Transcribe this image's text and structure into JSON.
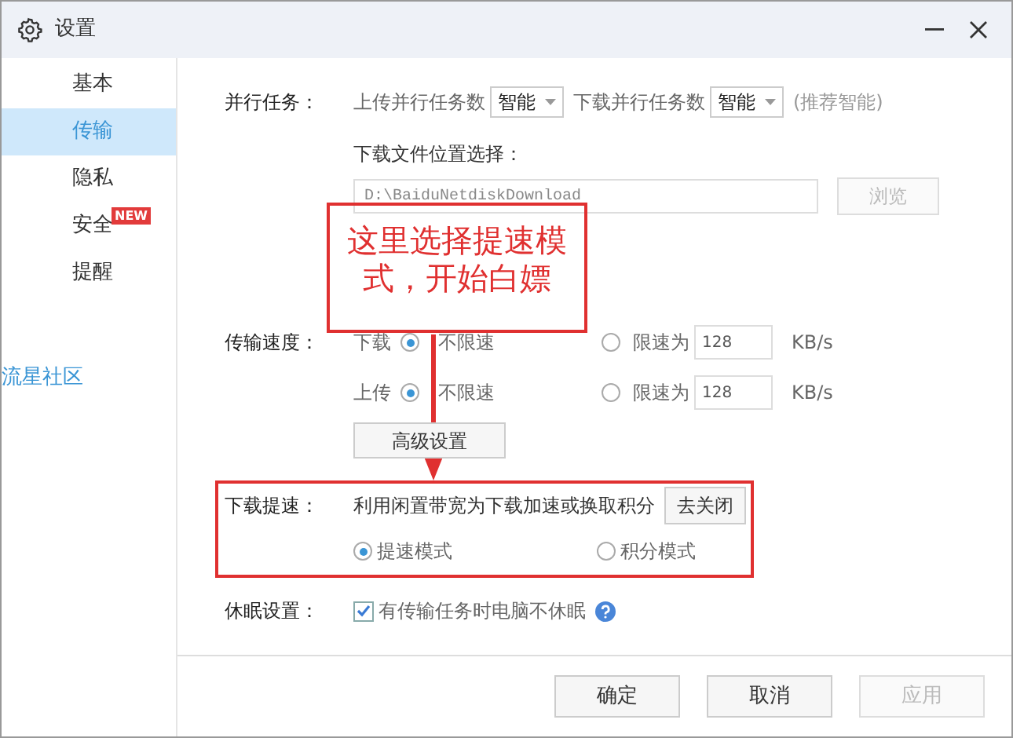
{
  "window": {
    "title": "设置"
  },
  "sidebar": {
    "items": [
      {
        "label": "基本",
        "selected": false
      },
      {
        "label": "传输",
        "selected": true
      },
      {
        "label": "隐私",
        "selected": false
      },
      {
        "label": "安全",
        "selected": false,
        "badge": "NEW"
      },
      {
        "label": "提醒",
        "selected": false
      }
    ],
    "link": "流星社区"
  },
  "parallel": {
    "label": "并行任务：",
    "upload_label": "上传并行任务数",
    "upload_value": "智能",
    "download_label": "下载并行任务数",
    "download_value": "智能",
    "hint": "(推荐智能)"
  },
  "download_location": {
    "label": "下载文件位置选择：",
    "path": "D:\\BaiduNetdiskDownload",
    "browse": "浏览",
    "browse_disabled": true
  },
  "speed": {
    "label": "传输速度：",
    "rows": [
      {
        "direction": "下载",
        "options": [
          {
            "label": "不限速",
            "selected": true
          },
          {
            "label": "限速为",
            "selected": false
          }
        ],
        "limit_value": "128",
        "unit": "KB/s"
      },
      {
        "direction": "上传",
        "options": [
          {
            "label": "不限速",
            "selected": true
          },
          {
            "label": "限速为",
            "selected": false
          }
        ],
        "limit_value": "128",
        "unit": "KB/s"
      }
    ],
    "advanced_button": "高级设置"
  },
  "boost": {
    "label": "下载提速：",
    "description": "利用闲置带宽为下载加速或换取积分",
    "button": "去关闭",
    "modes": [
      {
        "label": "提速模式",
        "selected": true
      },
      {
        "label": "积分模式",
        "selected": false
      }
    ]
  },
  "sleep": {
    "label": "休眠设置：",
    "option": "有传输任务时电脑不休眠",
    "checked": true
  },
  "footer": {
    "buttons": [
      {
        "label": "确定",
        "disabled": false
      },
      {
        "label": "取消",
        "disabled": false
      },
      {
        "label": "应用",
        "disabled": true
      }
    ]
  },
  "annotation": {
    "text": "这里选择提速模式，开始白嫖"
  }
}
